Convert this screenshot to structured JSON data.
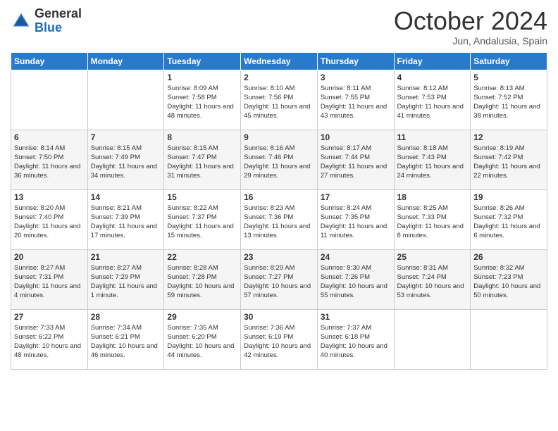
{
  "logo": {
    "general": "General",
    "blue": "Blue"
  },
  "header": {
    "month": "October 2024",
    "location": "Jun, Andalusia, Spain"
  },
  "weekdays": [
    "Sunday",
    "Monday",
    "Tuesday",
    "Wednesday",
    "Thursday",
    "Friday",
    "Saturday"
  ],
  "weeks": [
    [
      {
        "day": "",
        "info": ""
      },
      {
        "day": "",
        "info": ""
      },
      {
        "day": "1",
        "info": "Sunrise: 8:09 AM\nSunset: 7:58 PM\nDaylight: 11 hours and 48 minutes."
      },
      {
        "day": "2",
        "info": "Sunrise: 8:10 AM\nSunset: 7:56 PM\nDaylight: 11 hours and 45 minutes."
      },
      {
        "day": "3",
        "info": "Sunrise: 8:11 AM\nSunset: 7:55 PM\nDaylight: 11 hours and 43 minutes."
      },
      {
        "day": "4",
        "info": "Sunrise: 8:12 AM\nSunset: 7:53 PM\nDaylight: 11 hours and 41 minutes."
      },
      {
        "day": "5",
        "info": "Sunrise: 8:13 AM\nSunset: 7:52 PM\nDaylight: 11 hours and 38 minutes."
      }
    ],
    [
      {
        "day": "6",
        "info": "Sunrise: 8:14 AM\nSunset: 7:50 PM\nDaylight: 11 hours and 36 minutes."
      },
      {
        "day": "7",
        "info": "Sunrise: 8:15 AM\nSunset: 7:49 PM\nDaylight: 11 hours and 34 minutes."
      },
      {
        "day": "8",
        "info": "Sunrise: 8:15 AM\nSunset: 7:47 PM\nDaylight: 11 hours and 31 minutes."
      },
      {
        "day": "9",
        "info": "Sunrise: 8:16 AM\nSunset: 7:46 PM\nDaylight: 11 hours and 29 minutes."
      },
      {
        "day": "10",
        "info": "Sunrise: 8:17 AM\nSunset: 7:44 PM\nDaylight: 11 hours and 27 minutes."
      },
      {
        "day": "11",
        "info": "Sunrise: 8:18 AM\nSunset: 7:43 PM\nDaylight: 11 hours and 24 minutes."
      },
      {
        "day": "12",
        "info": "Sunrise: 8:19 AM\nSunset: 7:42 PM\nDaylight: 11 hours and 22 minutes."
      }
    ],
    [
      {
        "day": "13",
        "info": "Sunrise: 8:20 AM\nSunset: 7:40 PM\nDaylight: 11 hours and 20 minutes."
      },
      {
        "day": "14",
        "info": "Sunrise: 8:21 AM\nSunset: 7:39 PM\nDaylight: 11 hours and 17 minutes."
      },
      {
        "day": "15",
        "info": "Sunrise: 8:22 AM\nSunset: 7:37 PM\nDaylight: 11 hours and 15 minutes."
      },
      {
        "day": "16",
        "info": "Sunrise: 8:23 AM\nSunset: 7:36 PM\nDaylight: 11 hours and 13 minutes."
      },
      {
        "day": "17",
        "info": "Sunrise: 8:24 AM\nSunset: 7:35 PM\nDaylight: 11 hours and 11 minutes."
      },
      {
        "day": "18",
        "info": "Sunrise: 8:25 AM\nSunset: 7:33 PM\nDaylight: 11 hours and 8 minutes."
      },
      {
        "day": "19",
        "info": "Sunrise: 8:26 AM\nSunset: 7:32 PM\nDaylight: 11 hours and 6 minutes."
      }
    ],
    [
      {
        "day": "20",
        "info": "Sunrise: 8:27 AM\nSunset: 7:31 PM\nDaylight: 11 hours and 4 minutes."
      },
      {
        "day": "21",
        "info": "Sunrise: 8:27 AM\nSunset: 7:29 PM\nDaylight: 11 hours and 1 minute."
      },
      {
        "day": "22",
        "info": "Sunrise: 8:28 AM\nSunset: 7:28 PM\nDaylight: 10 hours and 59 minutes."
      },
      {
        "day": "23",
        "info": "Sunrise: 8:29 AM\nSunset: 7:27 PM\nDaylight: 10 hours and 57 minutes."
      },
      {
        "day": "24",
        "info": "Sunrise: 8:30 AM\nSunset: 7:26 PM\nDaylight: 10 hours and 55 minutes."
      },
      {
        "day": "25",
        "info": "Sunrise: 8:31 AM\nSunset: 7:24 PM\nDaylight: 10 hours and 53 minutes."
      },
      {
        "day": "26",
        "info": "Sunrise: 8:32 AM\nSunset: 7:23 PM\nDaylight: 10 hours and 50 minutes."
      }
    ],
    [
      {
        "day": "27",
        "info": "Sunrise: 7:33 AM\nSunset: 6:22 PM\nDaylight: 10 hours and 48 minutes."
      },
      {
        "day": "28",
        "info": "Sunrise: 7:34 AM\nSunset: 6:21 PM\nDaylight: 10 hours and 46 minutes."
      },
      {
        "day": "29",
        "info": "Sunrise: 7:35 AM\nSunset: 6:20 PM\nDaylight: 10 hours and 44 minutes."
      },
      {
        "day": "30",
        "info": "Sunrise: 7:36 AM\nSunset: 6:19 PM\nDaylight: 10 hours and 42 minutes."
      },
      {
        "day": "31",
        "info": "Sunrise: 7:37 AM\nSunset: 6:18 PM\nDaylight: 10 hours and 40 minutes."
      },
      {
        "day": "",
        "info": ""
      },
      {
        "day": "",
        "info": ""
      }
    ]
  ]
}
